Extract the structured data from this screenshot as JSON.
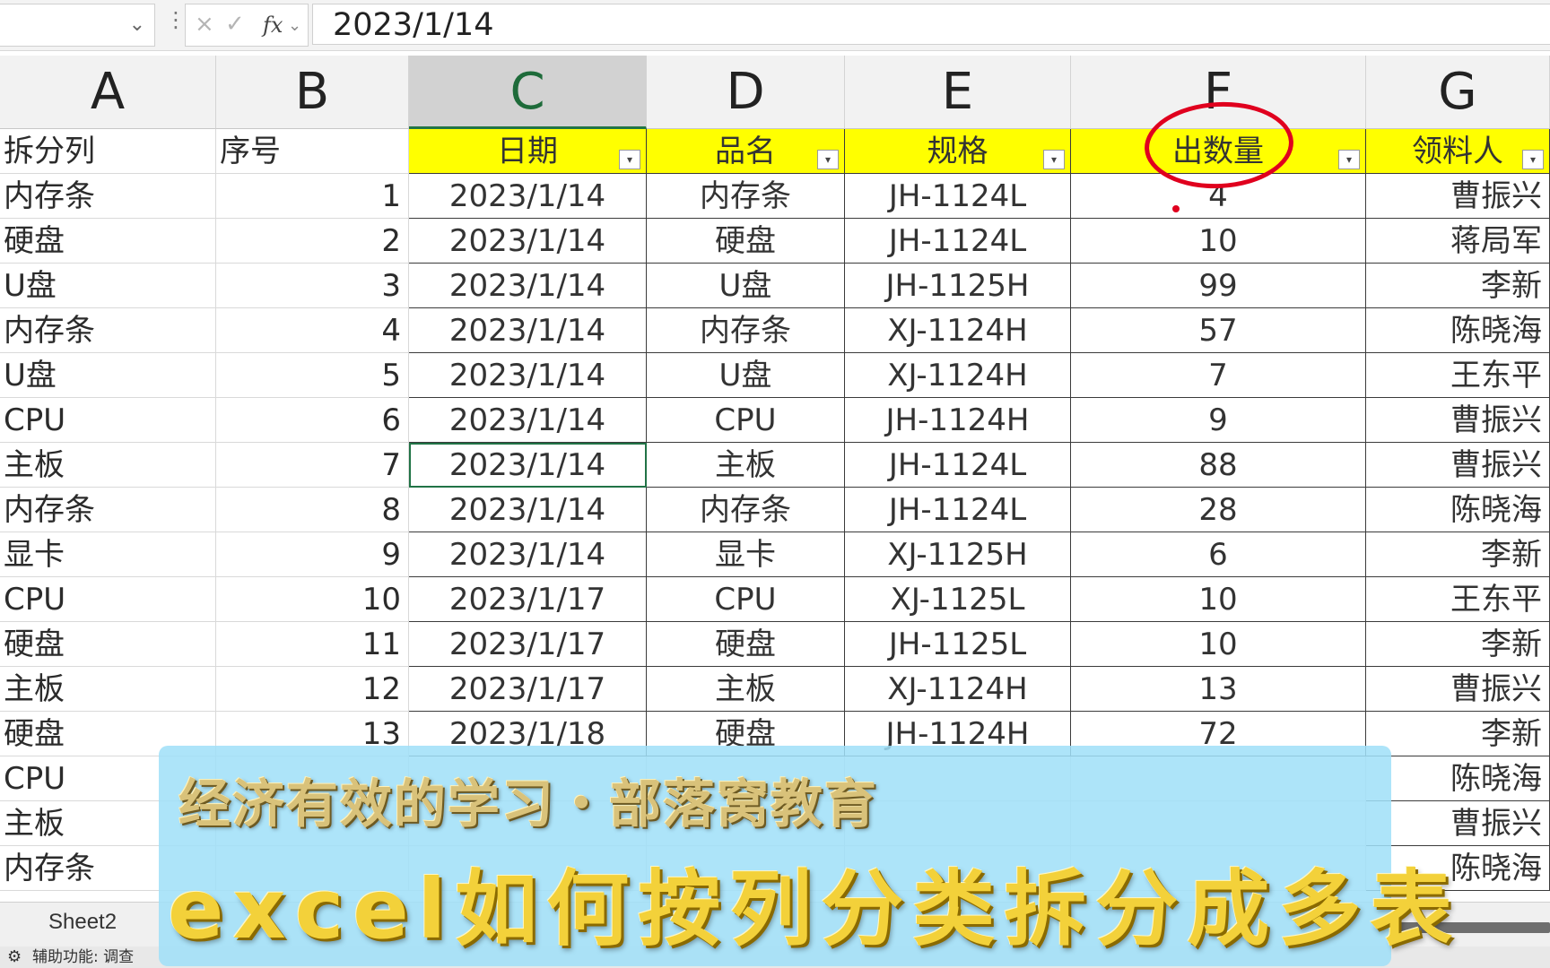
{
  "formula_bar": {
    "name_box": "",
    "cancel_icon": "×",
    "enter_icon": "✓",
    "fx_label": "fx",
    "value": "2023/1/14"
  },
  "columns": [
    "A",
    "B",
    "C",
    "D",
    "E",
    "F",
    "G"
  ],
  "selected_column": "C",
  "header_row": [
    "拆分列",
    "序号",
    "日期",
    "品名",
    "规格",
    "出数量",
    "领料人"
  ],
  "rows": [
    [
      "内存条",
      "1",
      "2023/1/14",
      "内存条",
      "JH-1124L",
      "4",
      "曹振兴"
    ],
    [
      "硬盘",
      "2",
      "2023/1/14",
      "硬盘",
      "JH-1124L",
      "10",
      "蒋局军"
    ],
    [
      "U盘",
      "3",
      "2023/1/14",
      "U盘",
      "JH-1125H",
      "99",
      "李新"
    ],
    [
      "内存条",
      "4",
      "2023/1/14",
      "内存条",
      "XJ-1124H",
      "57",
      "陈晓海"
    ],
    [
      "U盘",
      "5",
      "2023/1/14",
      "U盘",
      "XJ-1124H",
      "7",
      "王东平"
    ],
    [
      "CPU",
      "6",
      "2023/1/14",
      "CPU",
      "JH-1124H",
      "9",
      "曹振兴"
    ],
    [
      "主板",
      "7",
      "2023/1/14",
      "主板",
      "JH-1124L",
      "88",
      "曹振兴"
    ],
    [
      "内存条",
      "8",
      "2023/1/14",
      "内存条",
      "JH-1124L",
      "28",
      "陈晓海"
    ],
    [
      "显卡",
      "9",
      "2023/1/14",
      "显卡",
      "XJ-1125H",
      "6",
      "李新"
    ],
    [
      "CPU",
      "10",
      "2023/1/17",
      "CPU",
      "XJ-1125L",
      "10",
      "王东平"
    ],
    [
      "硬盘",
      "11",
      "2023/1/17",
      "硬盘",
      "JH-1125L",
      "10",
      "李新"
    ],
    [
      "主板",
      "12",
      "2023/1/17",
      "主板",
      "XJ-1124H",
      "13",
      "曹振兴"
    ],
    [
      "硬盘",
      "13",
      "2023/1/18",
      "硬盘",
      "JH-1124H",
      "72",
      "李新"
    ],
    [
      "CPU",
      "",
      "",
      "",
      "",
      "",
      "陈晓海"
    ],
    [
      "主板",
      "",
      "",
      "",
      "",
      "",
      "曹振兴"
    ],
    [
      "内存条",
      "",
      "",
      "",
      "",
      "",
      "陈晓海"
    ]
  ],
  "active_cell": {
    "row": 7,
    "col": "C"
  },
  "sheet_tab": "Sheet2",
  "status_text": "辅助功能: 调查",
  "banner": {
    "line1": "经济有效的学习・部落窝教育",
    "line2": "excel如何按列分类拆分成多表"
  },
  "colors": {
    "header_fill": "#ffff00",
    "annotation": "#e0001e",
    "banner_bg": "#a0e0f8",
    "excel_green": "#217346"
  }
}
